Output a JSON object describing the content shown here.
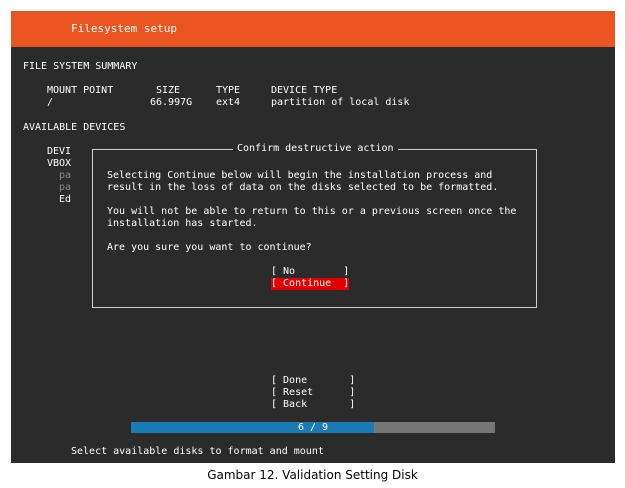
{
  "header": {
    "title": "Filesystem setup"
  },
  "summary": {
    "heading": "FILE SYSTEM SUMMARY",
    "columns": {
      "mount_point": "MOUNT POINT",
      "size": "SIZE",
      "type": "TYPE",
      "device_type": "DEVICE TYPE"
    },
    "row": {
      "mount_point": "/",
      "size": "66.997G",
      "type": "ext4",
      "device_type": "partition of local disk"
    }
  },
  "available": {
    "heading": "AVAILABLE DEVICES",
    "partial_lines": [
      "DEVI",
      "VBOX",
      "pa",
      "pa",
      "Ed"
    ]
  },
  "dialog": {
    "title": "Confirm destructive action",
    "para1_line1": "Selecting Continue below will begin the installation process and",
    "para1_line2": "result in the loss of data on the disks selected to be formatted.",
    "para2_line1": "You will not be able to return to this or a previous screen once the",
    "para2_line2": "installation has started.",
    "question": "Are you sure you want to continue?",
    "no_label": "[ No        ]",
    "continue_label": "[ Continue  ]"
  },
  "bottom_buttons": {
    "done": "[ Done       ]",
    "reset": "[ Reset      ]",
    "back": "[ Back       ]"
  },
  "progress": {
    "label": "6 / 9",
    "current": 6,
    "total": 9
  },
  "footer": {
    "hint": "Select available disks to format and mount"
  },
  "caption": "Gambar 12. Validation Setting Disk",
  "colors": {
    "header": "#e95420",
    "background": "#2b2b2b",
    "selected_button": "#e00000",
    "progress_fill": "#1b7bb4",
    "progress_track": "#777777"
  }
}
